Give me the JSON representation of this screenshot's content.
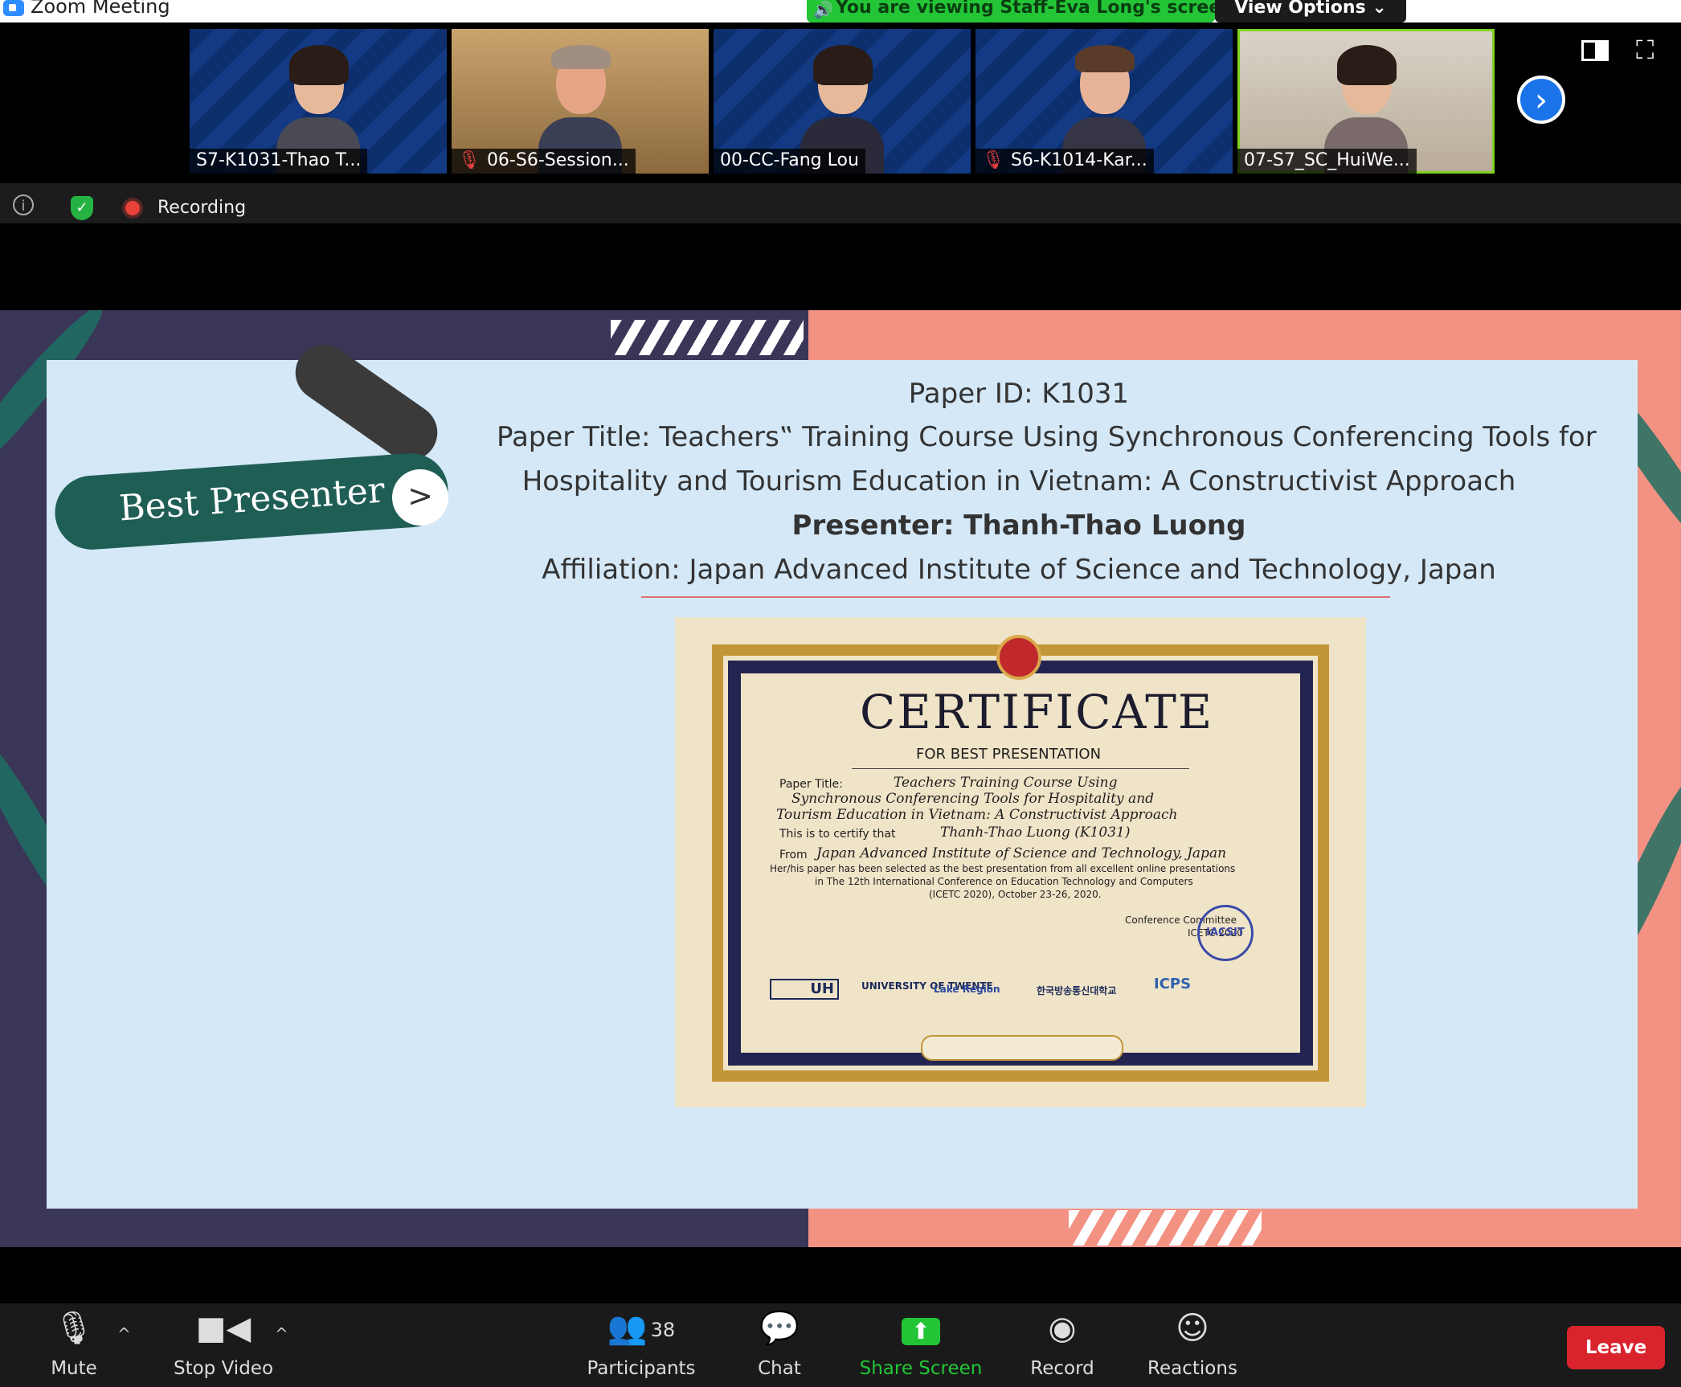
{
  "window": {
    "title": "Zoom Meeting",
    "viewing_banner": "You are viewing Staff-Eva Long's screen",
    "view_options": "View Options ⌄"
  },
  "gallery": {
    "tiles": [
      {
        "name": "S7-K1031-Thao T...",
        "muted": false
      },
      {
        "name": "06-S6-Session...",
        "muted": true
      },
      {
        "name": "00-CC-Fang Lou",
        "muted": false
      },
      {
        "name": "S6-K1014-Kar...",
        "muted": true
      },
      {
        "name": "07-S7_SC_HuiWe...",
        "muted": false,
        "active": true
      }
    ],
    "next_glyph": "›"
  },
  "status": {
    "recording": "Recording"
  },
  "slide": {
    "badge": "Best Presenter",
    "badge_arrow": ">",
    "paper_id": "Paper ID: K1031",
    "paper_title_line1": "Paper Title: Teachers‟ Training Course Using Synchronous Conferencing Tools for",
    "paper_title_line2": "Hospitality and Tourism Education in Vietnam: A Constructivist Approach",
    "presenter": "Presenter: Thanh-Thao Luong",
    "affiliation": "Affiliation: Japan Advanced Institute of Science and Technology, Japan"
  },
  "certificate": {
    "title": "CERTIFICATE",
    "subtitle": "FOR BEST PRESENTATION",
    "paper_title_label": "Paper Title:",
    "paper_title_l1": "Teachers  Training Course Using",
    "paper_title_l2": "Synchronous Conferencing Tools for Hospitality and",
    "paper_title_l3": "Tourism Education in Vietnam: A Constructivist Approach",
    "certify_label": "This is to certify that",
    "recipient": "Thanh-Thao Luong (K1031)",
    "from_label": "From",
    "from": "Japan Advanced Institute of Science and Technology, Japan",
    "body_line1": "Her/his paper has been selected as the best presentation from all excellent online presentations",
    "body_line2": "in The 12th International Conference on Education Technology and Computers",
    "body_line3": "(ICETC 2020), October 23-26, 2020.",
    "committee": "Conference Committee",
    "committee_event": "ICETC 2020",
    "stamp": "IACSIT",
    "logos": {
      "uh": "UH",
      "twente": "UNIVERSITY OF TWENTE.",
      "lake": "Lake Region",
      "korean": "한국방송통신대학교",
      "icps": "ICPS"
    }
  },
  "toolbar": {
    "mute": "Mute",
    "stop_video": "Stop Video",
    "participants": "Participants",
    "participants_count": "38",
    "chat": "Chat",
    "share_screen": "Share Screen",
    "record": "Record",
    "reactions": "Reactions",
    "leave": "Leave"
  },
  "colors": {
    "accent_green": "#23c537",
    "leave_red": "#d9232d",
    "zoom_blue": "#2d8cff"
  }
}
